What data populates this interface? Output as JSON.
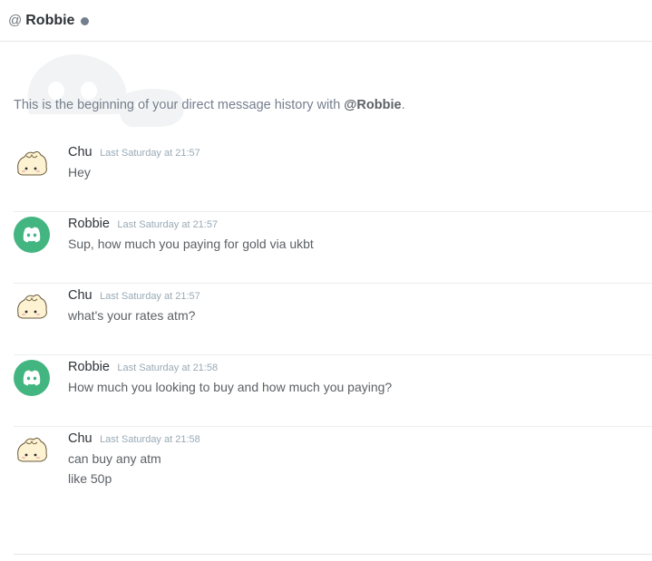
{
  "header": {
    "at_symbol": "@",
    "username": "Robbie",
    "status_icon": "status-dot-offline",
    "status_color": "#747f8d"
  },
  "intro": {
    "prefix": "This is the beginning of your direct message history with ",
    "mention": "@Robbie",
    "suffix": "."
  },
  "colors": {
    "discord_green": "#43b581",
    "divider": "#eceded"
  },
  "messages": [
    {
      "author": "Chu",
      "avatar": "dumpling-avatar",
      "timestamp": "Last Saturday at 21:57",
      "lines": [
        "Hey"
      ]
    },
    {
      "author": "Robbie",
      "avatar": "discord-logo-avatar",
      "timestamp": "Last Saturday at 21:57",
      "lines": [
        "Sup, how much you paying for gold via ukbt"
      ]
    },
    {
      "author": "Chu",
      "avatar": "dumpling-avatar",
      "timestamp": "Last Saturday at 21:57",
      "lines": [
        "what's your rates atm?"
      ]
    },
    {
      "author": "Robbie",
      "avatar": "discord-logo-avatar",
      "timestamp": "Last Saturday at 21:58",
      "lines": [
        "How much you looking to buy and how much you paying?"
      ]
    },
    {
      "author": "Chu",
      "avatar": "dumpling-avatar",
      "timestamp": "Last Saturday at 21:58",
      "lines": [
        "can buy any atm",
        "like 50p"
      ]
    }
  ]
}
